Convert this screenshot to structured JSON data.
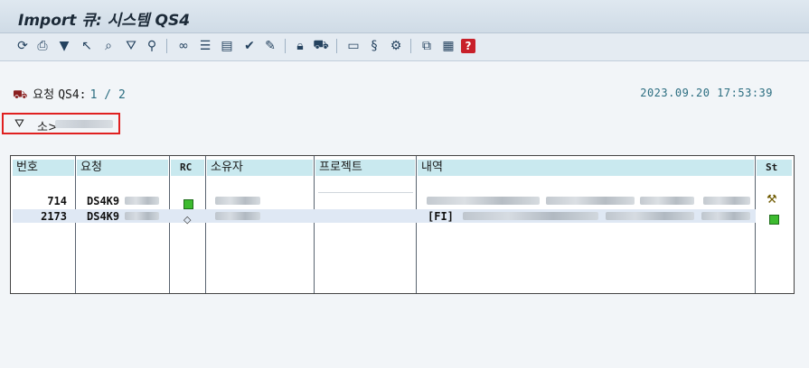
{
  "window": {
    "title": "Import 큐: 시스템 QS4"
  },
  "toolbar": {
    "icons": [
      "refresh-icon",
      "print-icon",
      "filter-icon",
      "select-icon",
      "zoom-icon",
      "funnel-icon",
      "hierarchy-icon",
      "glasses-icon",
      "list-icon",
      "form-icon",
      "checklist-icon",
      "edit-document-icon",
      "lock-icon",
      "truck-icon",
      "monitor-icon",
      "scroll-icon",
      "gear-document-icon",
      "copy-icon",
      "table-icon",
      "help-icon"
    ]
  },
  "header": {
    "request_label": "요청",
    "system_label": "QS4:",
    "page_counter": "1 / 2",
    "datetime": "2023.09.20 17:53:39"
  },
  "filter": {
    "label": "소>"
  },
  "table": {
    "columns": {
      "number": "번호",
      "request": "요청",
      "rc": "RC",
      "owner": "소유자",
      "project": "프로젝트",
      "description": "내역",
      "status": "St"
    },
    "rows": [
      {
        "number": "714",
        "request": "DS4K9",
        "rc_icon": "green-square-icon",
        "description": "",
        "status_icon": "crane-icon"
      },
      {
        "number": "2173",
        "request": "DS4K9",
        "rc_icon": "diamond-icon",
        "description": "[FI]",
        "status_icon": "green-square-icon"
      }
    ]
  },
  "colors": {
    "accent_teal": "#2b6d80",
    "header_cell": "#c9e9ef",
    "highlight_border": "#e02020",
    "status_green": "#3dbb2f"
  }
}
